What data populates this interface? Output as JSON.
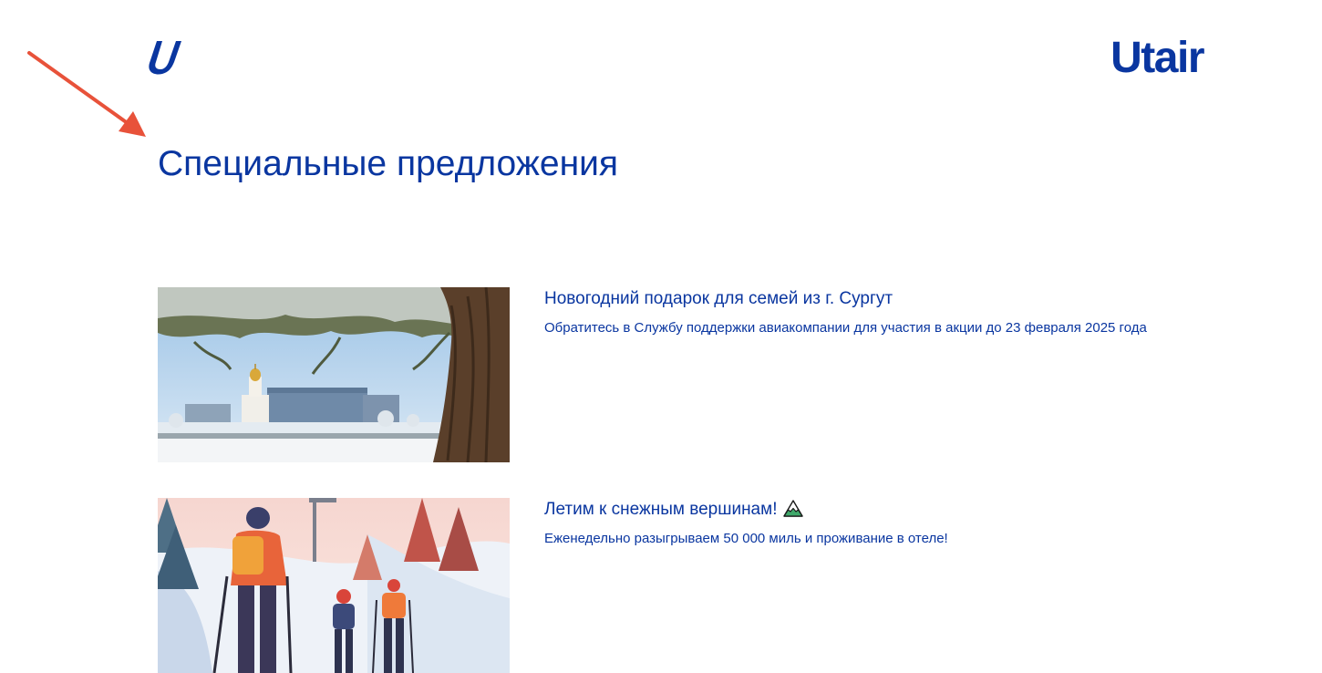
{
  "header": {
    "logo_icon": "utair-u-logo-icon",
    "brand_name": "Utair",
    "brand_color": "#0a36a0"
  },
  "annotation": {
    "icon": "red-arrow-icon",
    "color": "#e8523a"
  },
  "page": {
    "title": "Специальные предложения"
  },
  "offers": [
    {
      "title": "Новогодний подарок для семей из г. Сургут",
      "description": "Обратитесь в Службу поддержки авиакомпании для участия в акции до 23 февраля 2025 года",
      "image": "winter-city-church-pine-photo"
    },
    {
      "title": "Летим к снежным вершинам!",
      "title_icon": "snowy-mountain-emoji-icon",
      "description": "Еженедельно разыгрываем 50 000 миль и проживание в отеле!",
      "image": "family-skiing-illustration"
    }
  ]
}
